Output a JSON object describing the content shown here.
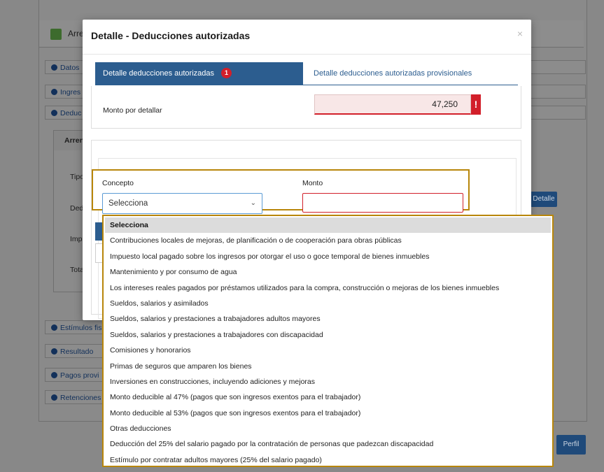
{
  "background": {
    "header_title": "Arre",
    "rows": [
      {
        "label": "Datos",
        "top": 0
      },
      {
        "label": "Ingres",
        "top": 0
      },
      {
        "label": "Deduc",
        "top": 0
      }
    ],
    "lower_rows": [
      "Estímulos fis",
      "Resultado",
      "Pagos provi",
      "Retenciones"
    ],
    "subpanel_title": "Arren",
    "labels": [
      "Tipo",
      "Ded",
      "Imp",
      "Tota"
    ],
    "detalle_button": "Detalle",
    "perfil_button": "Perfil"
  },
  "modal": {
    "title": "Detalle - Deducciones autorizadas",
    "close": "×",
    "tabs": {
      "active": "Detalle deducciones autorizadas",
      "badge": "1",
      "inactive": "Detalle deducciones autorizadas provisionales"
    },
    "monto_label": "Monto por detallar",
    "monto_value": "47,250",
    "error_icon": "!",
    "concepto_label": "Concepto",
    "monto2_label": "Monto",
    "select_value": "Selecciona",
    "select_chevron": "⌄"
  },
  "dropdown": {
    "options": [
      "Selecciona",
      "Contribuciones locales de mejoras, de planificación o de cooperación para obras públicas",
      "Impuesto local pagado sobre los ingresos por otorgar el uso o goce temporal de bienes inmuebles",
      "Mantenimiento y por consumo de agua",
      "Los intereses reales pagados por préstamos utilizados para la compra, construcción o mejoras de los bienes inmuebles",
      "Sueldos, salarios y asimilados",
      "Sueldos, salarios y prestaciones a trabajadores adultos mayores",
      "Sueldos, salarios y prestaciones a trabajadores con discapacidad",
      "Comisiones y honorarios",
      "Primas de seguros que amparen los bienes",
      "Inversiones en construcciones, incluyendo adiciones y mejoras",
      "Monto deducible al 47% (pagos que son ingresos exentos para el trabajador)",
      "Monto deducible al 53% (pagos que son ingresos exentos para el trabajador)",
      "Otras deducciones",
      "Deducción del 25% del salario pagado por la contratación de personas que padezcan discapacidad",
      "Estímulo por contratar adultos mayores (25% del salario pagado)"
    ],
    "selected_index": 0
  }
}
